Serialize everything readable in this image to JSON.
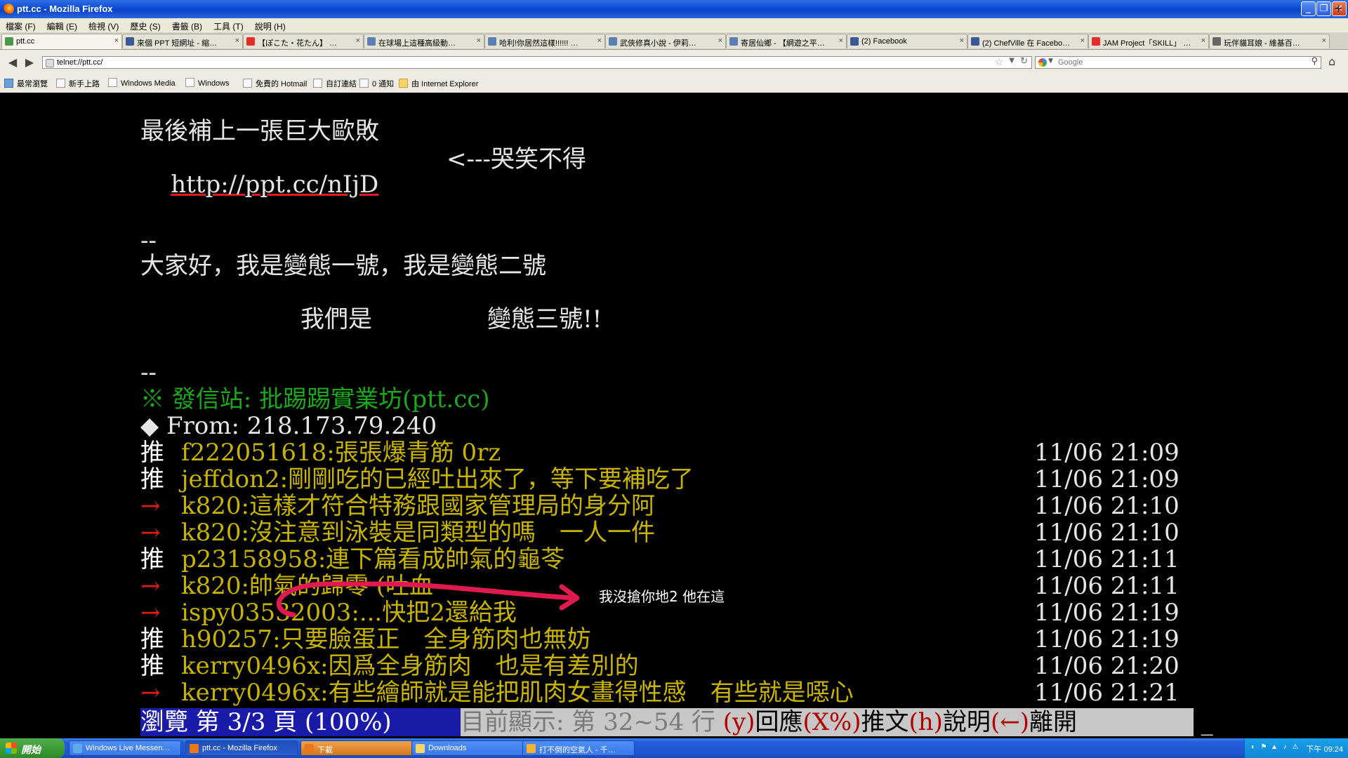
{
  "window": {
    "title": "ptt.cc - Mozilla Firefox",
    "min_glyph": "_",
    "max_glyph": "❐",
    "close_glyph": "✕"
  },
  "menu": [
    "檔案 (F)",
    "編輯 (E)",
    "檢視 (V)",
    "歷史 (S)",
    "書籤 (B)",
    "工具 (T)",
    "說明 (H)"
  ],
  "tabs": [
    {
      "label": "ptt.cc",
      "icon_color": "#4a9a4a",
      "active": true
    },
    {
      "label": "來個 PPT 短網址 - 縮…",
      "icon_color": "#3b5998"
    },
    {
      "label": "【ぽこた・花たん】 …",
      "icon_color": "#e52d27"
    },
    {
      "label": "在球場上這種高級動…",
      "icon_color": "#5a7fb5"
    },
    {
      "label": "哈利!你居然這樣!!!!!! …",
      "icon_color": "#5a7fb5"
    },
    {
      "label": "武俠修真小說 - 伊莉…",
      "icon_color": "#5a7fb5"
    },
    {
      "label": "寄居仙鄉 - 【網遊之平…",
      "icon_color": "#5a7fb5"
    },
    {
      "label": "(2) Facebook",
      "icon_color": "#3b5998"
    },
    {
      "label": "(2) ChefVille 在 Facebo…",
      "icon_color": "#3b5998"
    },
    {
      "label": "JAM Project「SKILL」 …",
      "icon_color": "#e52d27"
    },
    {
      "label": "玩伴貓耳娘 - 維基百…",
      "icon_color": "#666666"
    }
  ],
  "tab_close": "×",
  "new_tab": "+",
  "nav": {
    "back": "◀",
    "forward": "▶",
    "url": "telnet://ptt.cc/",
    "star": "☆",
    "dropdown": "▼",
    "reload": "↻",
    "search_placeholder": "Google",
    "search_glyph": "⚲",
    "home_glyph": "⌂"
  },
  "bookmarks": [
    {
      "label": "最常瀏覽",
      "type": "mv"
    },
    {
      "label": "新手上路",
      "type": "page"
    },
    {
      "label": "Windows Media",
      "type": "page"
    },
    {
      "label": "Windows",
      "type": "page"
    },
    {
      "label": "免費的 Hotmail",
      "type": "page"
    },
    {
      "label": "自訂連結",
      "type": "page"
    },
    {
      "label": "0 通知",
      "type": "page"
    },
    {
      "label": "由 Internet Explorer",
      "type": "folder"
    }
  ],
  "terminal": {
    "sig_line1": "最後補上一張巨大歐敗",
    "url_text": "http://ppt.cc/nIjD",
    "url_comment": "<---哭笑不得",
    "sep1": "--",
    "greet": "大家好，我是變態一號，我是變態二號",
    "we_are": "我們是",
    "num_three": "變態三號!!",
    "sep2": "--",
    "origin_station": "※ 發信站: 批踢踢實業坊(ptt.cc)",
    "from_line": "◆ From: 218.173.79.240",
    "pushes": [
      {
        "tag": "推",
        "user": "f222051618",
        "text": ":張張爆青筋 0rz",
        "time": "11/06 21:09"
      },
      {
        "tag": "推",
        "user": "jeffdon2",
        "text": ":剛剛吃的已經吐出來了，等下要補吃了",
        "time": "11/06 21:09"
      },
      {
        "tag": "→",
        "user": "k820",
        "text": ":這樣才符合特務跟國家管理局的身分阿",
        "time": "11/06 21:10"
      },
      {
        "tag": "→",
        "user": "k820",
        "text": ":沒注意到泳裝是同類型的嗎　一人一件",
        "time": "11/06 21:10"
      },
      {
        "tag": "推",
        "user": "p23158958",
        "text": ":連下篇看成帥氣的龜苓",
        "time": "11/06 21:11"
      },
      {
        "tag": "→",
        "user": "k820",
        "text": ":帥氣的歸零 (吐血",
        "time": "11/06 21:11"
      },
      {
        "tag": "→",
        "user": "ispy03532003",
        "text": ":...快把2還給我",
        "time": "11/06 21:19"
      },
      {
        "tag": "推",
        "user": "h90257",
        "text": ":只要臉蛋正　全身筋肉也無妨",
        "time": "11/06 21:19"
      },
      {
        "tag": "推",
        "user": "kerry0496x",
        "text": ":因爲全身筋肉　也是有差別的",
        "time": "11/06 21:20"
      },
      {
        "tag": "→",
        "user": "kerry0496x",
        "text": ":有些繪師就是能把肌肉女畫得性感　有些就是噁心",
        "time": "11/06 21:21"
      }
    ],
    "annotation": "我沒搶你地2 他在這",
    "status": {
      "browse": " 瀏覽 第 3/3 頁 (100%) ",
      "showing": " 目前顯示: 第 32~54 行 ",
      "k_y": "(y)",
      "reply": "回應",
      "k_x": "(X%)",
      "push": "推文",
      "k_h": "(h)",
      "help": "說明",
      "k_left": "(←)",
      "leave": "離開",
      "cursor": " _"
    },
    "colors": {
      "push_tag": "#ffffff",
      "arrow_tag": "#e21a1a",
      "user": "#c8b400",
      "station": "#1ba81b",
      "annotation_stroke": "#e0194f"
    }
  },
  "taskbar": {
    "start": "開始",
    "items": [
      {
        "label": "Windows Live Messen…",
        "icon_color": "#5fa9e8"
      },
      {
        "label": "ptt.cc - Mozilla Firefox",
        "icon_color": "#e8781a",
        "active": true
      },
      {
        "label": "下載",
        "icon_color": "#e8781a",
        "orange": true
      },
      {
        "label": "Downloads",
        "icon_color": "#f5d46a"
      },
      {
        "label": "打不倒的空氣人 - 千…",
        "icon_color": "#f5b130"
      }
    ],
    "tray_icons": [
      "◐",
      "⚑",
      "▲",
      "♪",
      "⚠"
    ],
    "clock": "下午 09:24"
  }
}
